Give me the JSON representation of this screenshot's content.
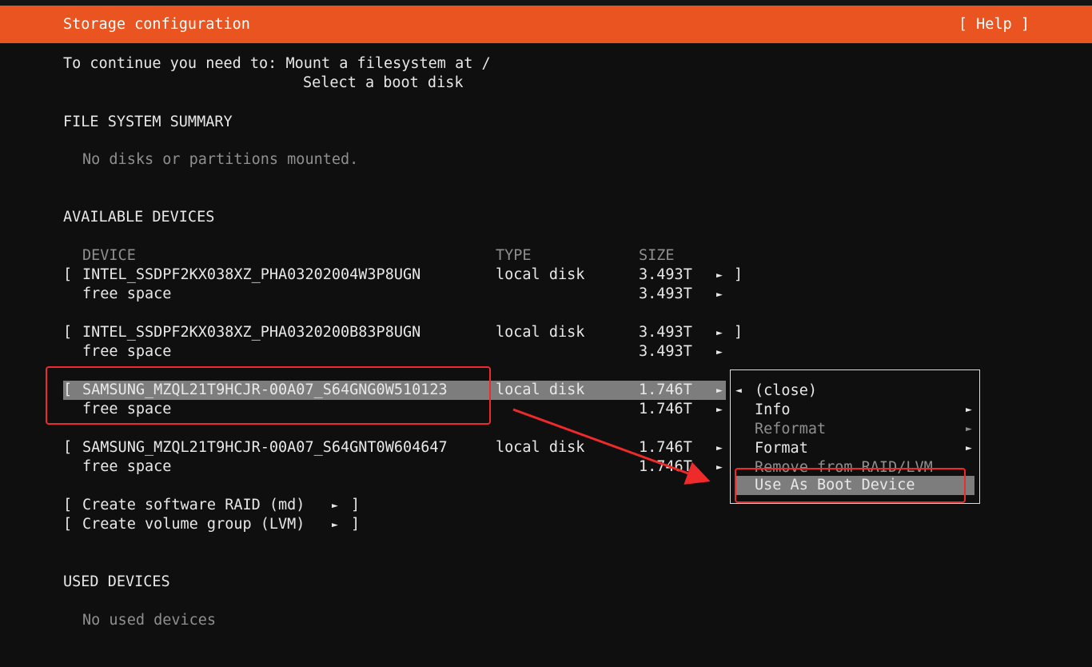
{
  "header": {
    "title": "Storage configuration",
    "help": "[ Help ]"
  },
  "requirements": {
    "line1": "To continue you need to: Mount a filesystem at /",
    "line2": "Select a boot disk"
  },
  "fs_summary": {
    "heading": "FILE SYSTEM SUMMARY",
    "empty": "No disks or partitions mounted."
  },
  "available": {
    "heading": "AVAILABLE DEVICES",
    "columns": {
      "device": "DEVICE",
      "type": "TYPE",
      "size": "SIZE"
    },
    "devices": [
      {
        "name": "INTEL_SSDPF2KX038XZ_PHA03202004W3P8UGN",
        "type": "local disk",
        "size": "3.493T",
        "free_label": "free space",
        "free_size": "3.493T"
      },
      {
        "name": "INTEL_SSDPF2KX038XZ_PHA0320200B83P8UGN",
        "type": "local disk",
        "size": "3.493T",
        "free_label": "free space",
        "free_size": "3.493T"
      },
      {
        "name": "SAMSUNG_MZQL21T9HCJR-00A07_S64GNG0W510123",
        "type": "local disk",
        "size": "1.746T",
        "free_label": "free space",
        "free_size": "1.746T"
      },
      {
        "name": "SAMSUNG_MZQL21T9HCJR-00A07_S64GNT0W604647",
        "type": "local disk",
        "size": "1.746T",
        "free_label": "free space",
        "free_size": "1.746T"
      }
    ],
    "actions": [
      "Create software RAID (md)",
      "Create volume group (LVM)"
    ]
  },
  "used": {
    "heading": "USED DEVICES",
    "empty": "No used devices"
  },
  "context_menu": {
    "items": [
      {
        "label": "(close)"
      },
      {
        "label": "Info"
      },
      {
        "label": "Reformat"
      },
      {
        "label": "Format"
      },
      {
        "label": "Remove from RAID/LVM"
      },
      {
        "label": "Use As Boot Device"
      }
    ]
  },
  "colors": {
    "accent": "#e95420",
    "highlight": "#ee2a2a",
    "selection": "#7d7d7d"
  }
}
